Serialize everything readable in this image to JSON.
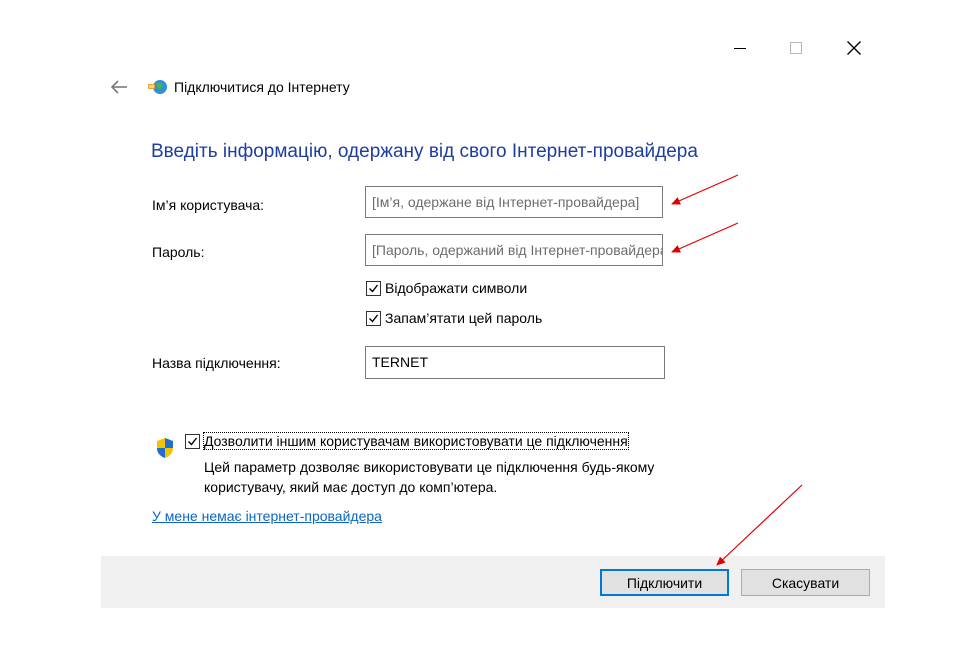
{
  "window": {
    "title": "Підключитися до Інтернету",
    "controls": {
      "minimize": "minimize-icon",
      "maximize": "maximize-icon",
      "close": "close-icon"
    }
  },
  "form": {
    "heading": "Введіть інформацію, одержану від свого Інтернет-провайдера",
    "username": {
      "label": "Ім’я користувача:",
      "placeholder": "[Ім’я, одержане від Інтернет-провайдера]",
      "value": ""
    },
    "password": {
      "label": "Пароль:",
      "placeholder": "[Пароль, одержаний від Інтернет-провайдера]",
      "value": ""
    },
    "show_chars": {
      "label": "Відображати символи",
      "checked": true
    },
    "remember_password": {
      "label": "Запам’ятати цей пароль",
      "checked": true
    },
    "connection_name": {
      "label": "Назва підключення:",
      "value": "TERNET"
    },
    "allow_others": {
      "label": "Дозволити іншим користувачам використовувати це підключення",
      "checked": true,
      "description_line1": "Цей параметр дозволяє використовувати це підключення будь-якому",
      "description_line2": "користувачу, який має доступ до комп’ютера."
    },
    "no_isp_link": "У мене немає інтернет-провайдера"
  },
  "footer": {
    "connect_label": "Підключити",
    "cancel_label": "Скасувати"
  },
  "colors": {
    "heading": "#1e3e9e",
    "link": "#0a66c2",
    "annotation_arrow": "#e00000",
    "primary_border": "#0078d7"
  }
}
